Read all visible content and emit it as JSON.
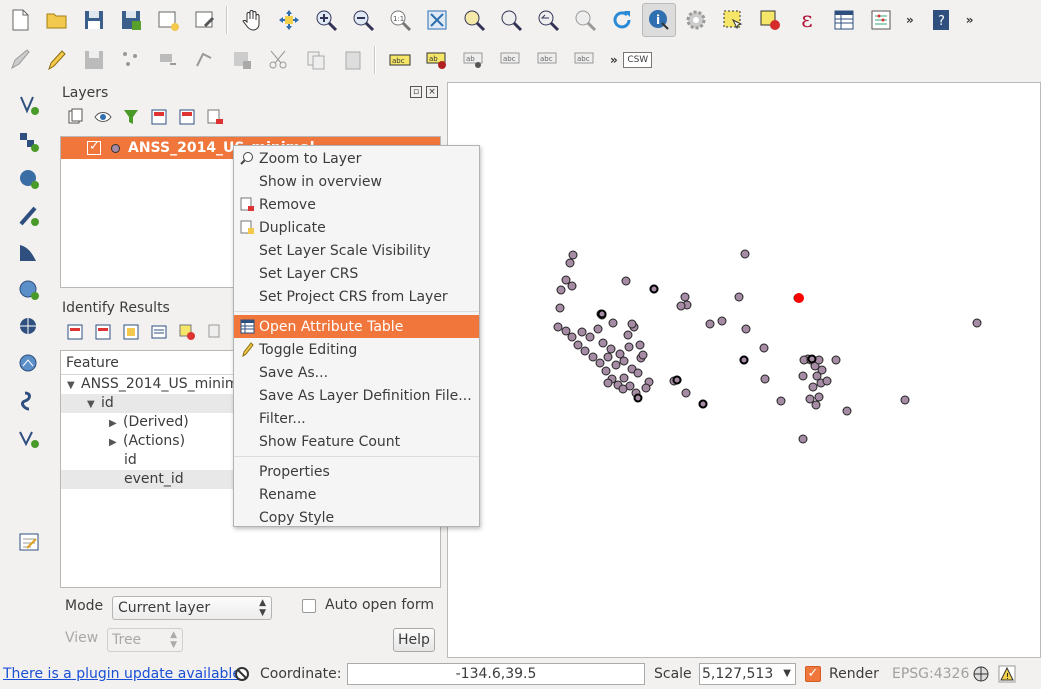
{
  "layers_panel": {
    "title": "Layers",
    "layer_name": "ANSS_2014_US_minimal"
  },
  "identify_panel": {
    "title": "Identify Results",
    "column_header": "Feature",
    "rows": [
      {
        "label": "ANSS_2014_US_minim"
      },
      {
        "label": "id"
      },
      {
        "label": "(Derived)"
      },
      {
        "label": "(Actions)"
      },
      {
        "label": "id"
      },
      {
        "label": "event_id"
      }
    ],
    "mode_label": "Mode",
    "mode_value": "Current layer",
    "auto_open_label": "Auto open form",
    "view_label": "View",
    "view_value": "Tree",
    "help_label": "Help"
  },
  "context_menu": {
    "items": [
      {
        "label": "Zoom to Layer"
      },
      {
        "label": "Show in overview"
      },
      {
        "label": "Remove"
      },
      {
        "label": "Duplicate"
      },
      {
        "label": "Set Layer Scale Visibility"
      },
      {
        "label": "Set Layer CRS"
      },
      {
        "label": "Set Project CRS from Layer"
      },
      {
        "label": "Open Attribute Table"
      },
      {
        "label": "Toggle Editing"
      },
      {
        "label": "Save As..."
      },
      {
        "label": "Save As Layer Definition File..."
      },
      {
        "label": "Filter..."
      },
      {
        "label": "Show Feature Count"
      },
      {
        "label": "Properties"
      },
      {
        "label": "Rename"
      },
      {
        "label": "Copy Style"
      }
    ]
  },
  "toolbar": {
    "csw_label": "CSW",
    "overflow": "»",
    "epsilon": "ε"
  },
  "statusbar": {
    "plugin_message": "There is a plugin update available",
    "coordinate_label": "Coordinate:",
    "coordinate_value": "-134.6,39.5",
    "scale_label": "Scale",
    "scale_value": "5,127,513",
    "render_label": "Render",
    "crs": "EPSG:4326"
  },
  "colors": {
    "accent": "#f0763c",
    "point_fill": "#a58ba4",
    "highlight_point": "#ff0000"
  }
}
